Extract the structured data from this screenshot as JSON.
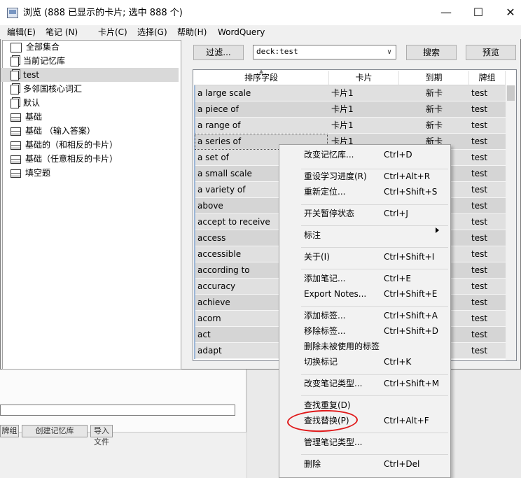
{
  "window": {
    "title": "浏览 (888 已显示的卡片; 选中 888 个)",
    "minimize_glyph": "—",
    "maximize_glyph": "☐",
    "close_glyph": "✕"
  },
  "menu": [
    "编辑(E)",
    "笔记 (N)",
    "卡片(C)",
    "选择(G)",
    "帮助(H)",
    "WordQuery"
  ],
  "sidebar": {
    "items": [
      {
        "label": "全部集合",
        "icon": "collection-icon"
      },
      {
        "label": "当前记忆库",
        "icon": "deck-icon"
      },
      {
        "label": "test",
        "icon": "deck-icon",
        "selected": true
      },
      {
        "label": "多邻国核心词汇",
        "icon": "deck-icon"
      },
      {
        "label": "默认",
        "icon": "deck-icon"
      },
      {
        "label": "基础",
        "icon": "note-type-icon"
      },
      {
        "label": "基础 （输入答案）",
        "icon": "note-type-icon"
      },
      {
        "label": "基础的（和相反的卡片）",
        "icon": "note-type-icon"
      },
      {
        "label": "基础（任意相反的卡片）",
        "icon": "note-type-icon"
      },
      {
        "label": "填空题",
        "icon": "note-type-icon"
      }
    ]
  },
  "toolbar": {
    "filter_label": "过滤...",
    "search_value": "deck:test",
    "search_label": "搜索",
    "preview_label": "预览"
  },
  "table": {
    "columns": [
      "排序字段",
      "卡片",
      "到期",
      "牌组"
    ],
    "rows": [
      [
        "a large scale",
        "卡片1",
        "新卡",
        "test"
      ],
      [
        "a piece of",
        "卡片1",
        "新卡",
        "test"
      ],
      [
        "a range of",
        "卡片1",
        "新卡",
        "test"
      ],
      [
        "a series of",
        "卡片1",
        "新卡",
        "test"
      ],
      [
        "a set of",
        "",
        "",
        "test"
      ],
      [
        "a small scale",
        "",
        "",
        "test"
      ],
      [
        "a variety of",
        "",
        "",
        "test"
      ],
      [
        "above",
        "",
        "",
        "test"
      ],
      [
        "accept to receive",
        "",
        "",
        "test"
      ],
      [
        "access",
        "",
        "",
        "test"
      ],
      [
        "accessible",
        "",
        "",
        "test"
      ],
      [
        "according to",
        "",
        "",
        "test"
      ],
      [
        "accuracy",
        "",
        "",
        "test"
      ],
      [
        "achieve",
        "",
        "",
        "test"
      ],
      [
        "acorn",
        "",
        "",
        "test"
      ],
      [
        "act",
        "",
        "",
        "test"
      ],
      [
        "adapt",
        "",
        "",
        "test"
      ]
    ]
  },
  "context_menu": {
    "items": [
      {
        "label": "改变记忆库...",
        "shortcut": "Ctrl+D"
      },
      {
        "label": "重设学习进度(R)",
        "shortcut": "Ctrl+Alt+R"
      },
      {
        "label": "重新定位...",
        "shortcut": "Ctrl+Shift+S"
      },
      {
        "label": "开关暂停状态",
        "shortcut": "Ctrl+J"
      },
      {
        "label": "标注",
        "shortcut": ""
      },
      {
        "label": "关于(I)",
        "shortcut": "Ctrl+Shift+I"
      },
      {
        "label": "添加笔记...",
        "shortcut": "Ctrl+E"
      },
      {
        "label": "Export Notes...",
        "shortcut": "Ctrl+Shift+E"
      },
      {
        "label": "添加标签...",
        "shortcut": "Ctrl+Shift+A"
      },
      {
        "label": "移除标签...",
        "shortcut": "Ctrl+Shift+D"
      },
      {
        "label": "删除未被使用的标签",
        "shortcut": ""
      },
      {
        "label": "切换标记",
        "shortcut": "Ctrl+K"
      },
      {
        "label": "改变笔记类型...",
        "shortcut": "Ctrl+Shift+M"
      },
      {
        "label": "查找重复(D)",
        "shortcut": ""
      },
      {
        "label": "查找替换(P)",
        "shortcut": "Ctrl+Alt+F",
        "highlighted": true
      },
      {
        "label": "管理笔记类型...",
        "shortcut": ""
      },
      {
        "label": "删除",
        "shortcut": "Ctrl+Del"
      }
    ]
  },
  "background_window": {
    "buttons": [
      "牌组",
      "创建记忆库",
      "导入文件"
    ]
  },
  "colors": {
    "row_bg": "#e0e0e0",
    "selected_sidebar": "#d9d9d9",
    "highlight_ellipse": "#e0191a"
  }
}
